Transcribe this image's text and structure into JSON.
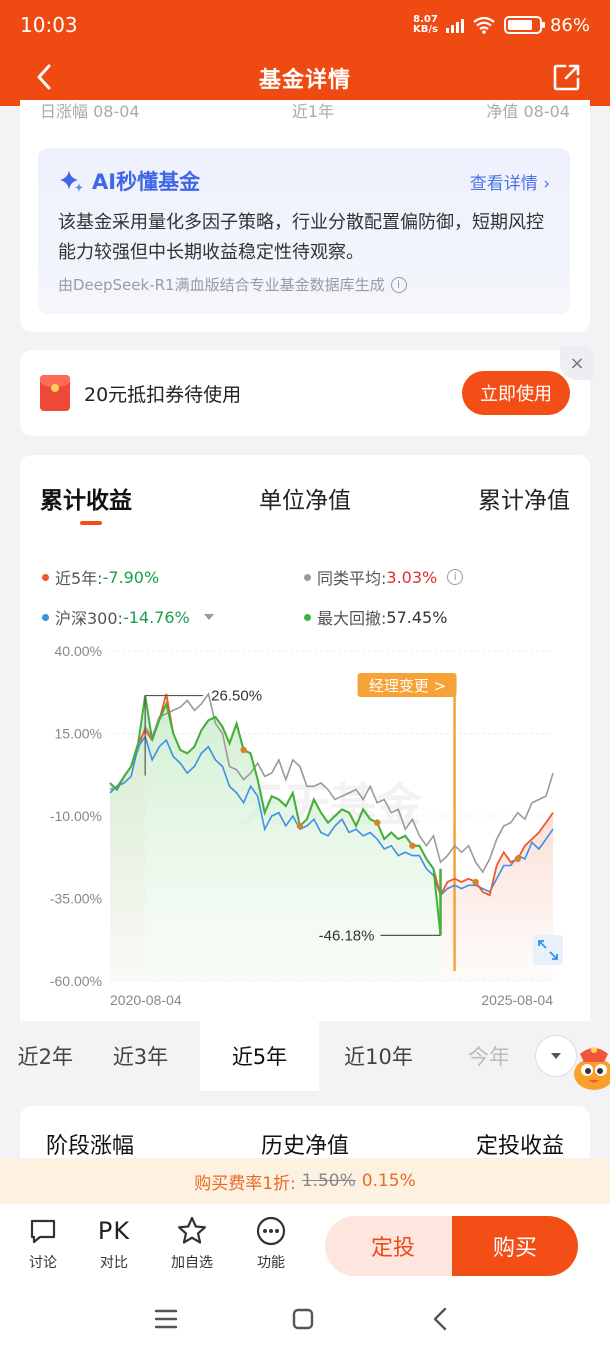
{
  "status_bar": {
    "time": "10:03",
    "net_speed_value": "8.07",
    "net_speed_unit": "KB/s",
    "battery": "86"
  },
  "header": {
    "title": "基金详情",
    "back_icon": "chevron-left-icon",
    "share_icon": "share-icon"
  },
  "peek_row": [
    "日涨幅 08-04",
    "近1年",
    "净值 08-04"
  ],
  "ai_card": {
    "title": "AI秒懂基金",
    "link": "查看详情 ›",
    "text": "该基金采用量化多因子策略，行业分散配置偏防御，短期风控能力较强但中长期收益稳定性待观察。",
    "source": "由DeepSeek-R1满血版结合专业基金数据库生成"
  },
  "coupon": {
    "text": "20元抵扣券待使用",
    "button": "立即使用",
    "close": "×"
  },
  "chart_tabs": [
    "累计收益",
    "单位净值",
    "累计净值"
  ],
  "legend": {
    "fund_label": "近5年:",
    "fund_value": "-7.90%",
    "peer_label": "同类平均:",
    "peer_value": "3.03%",
    "index_label": "沪深300:",
    "index_value": "-14.76%",
    "drawdown_label": "最大回撤:",
    "drawdown_value": "57.45%"
  },
  "colors": {
    "brand": "#f04a13",
    "fund": "#f0582a",
    "peer": "#9a9a9a",
    "index": "#3d8fe8",
    "drawdown": "#3fb23a",
    "up": "#e02c2c",
    "down": "#18a14a",
    "manager_change": "#f6a236"
  },
  "chart_data": {
    "type": "line",
    "x_start": "2020-08-04",
    "x_end": "2025-08-04",
    "xtick_labels": [
      "2020-08-04",
      "2025-08-04"
    ],
    "ytick_labels": [
      "40.00%",
      "15.00%",
      "-10.00%",
      "-35.00%",
      "-60.00%"
    ],
    "ylim": [
      -60,
      40
    ],
    "grid": true,
    "watermark": "天天基金",
    "peak_label": "26.50%",
    "trough_label": "-46.18%",
    "manager_change_label": "经理变更 >",
    "series": [
      {
        "name": "近5年",
        "values": [
          0,
          -2,
          2,
          5,
          12,
          16,
          13,
          19,
          27,
          15,
          10,
          9,
          11,
          16,
          19,
          20,
          17,
          12,
          18,
          10,
          9,
          1,
          -9,
          -4,
          -5,
          -7,
          -3,
          -13,
          -11,
          -5,
          -9,
          -12,
          -10,
          -8,
          -9,
          -13,
          -8,
          -11,
          -12,
          -17,
          -15,
          -17,
          -16,
          -19,
          -19,
          -23,
          -26,
          -34,
          -30,
          -29,
          -30,
          -29,
          -30,
          -33,
          -34,
          -25,
          -21,
          -24,
          -23,
          -19,
          -17,
          -15,
          -12,
          -9
        ]
      },
      {
        "name": "同类平均",
        "values": [
          -2,
          -1,
          2,
          5,
          10,
          17,
          14,
          20,
          21,
          22,
          23,
          25,
          22,
          24,
          27,
          18,
          15,
          5,
          4,
          1,
          3,
          6,
          2,
          3,
          7,
          1,
          7,
          5,
          -1,
          -1,
          0,
          -2,
          -5,
          -4,
          -3,
          -2,
          -5,
          -1,
          -6,
          -5,
          -9,
          -8,
          -14,
          -11,
          -16,
          -19,
          -16,
          -24,
          -22,
          -19,
          -21,
          -19,
          -24,
          -27,
          -23,
          -17,
          -13,
          -12,
          -9,
          -11,
          -6,
          -5,
          -4,
          3
        ]
      },
      {
        "name": "沪深300",
        "values": [
          -3,
          -1,
          0,
          2,
          11,
          14,
          7,
          11,
          13,
          8,
          6,
          3,
          5,
          9,
          11,
          7,
          5,
          -1,
          -3,
          -6,
          -1,
          -4,
          -14,
          -10,
          -9,
          -13,
          -10,
          -14,
          -13,
          -11,
          -15,
          -16,
          -13,
          -11,
          -15,
          -14,
          -16,
          -15,
          -17,
          -20,
          -19,
          -22,
          -21,
          -22,
          -22,
          -26,
          -28,
          -34,
          -32,
          -31,
          -32,
          -31,
          -31,
          -32,
          -33,
          -29,
          -25,
          -25,
          -22,
          -23,
          -18,
          -20,
          -17,
          -14
        ]
      },
      {
        "name": "最大回撤",
        "values": [
          0,
          -2,
          2,
          5,
          12,
          26.5,
          13,
          19,
          24,
          15,
          10,
          9,
          11,
          16,
          19,
          20,
          17,
          12,
          18,
          10,
          9,
          1,
          -9,
          -4,
          -5,
          -7,
          -3,
          -13,
          -11,
          -5,
          -9,
          -12,
          -10,
          -8,
          -9,
          -13,
          -8,
          -11,
          -12,
          -17,
          -15,
          -17,
          -16,
          -19,
          -19,
          -23,
          -26,
          -46.18
        ]
      }
    ]
  },
  "periods": [
    "近2年",
    "近3年",
    "近5年",
    "近10年",
    "今年来"
  ],
  "sections": [
    "阶段涨幅",
    "历史净值",
    "定投收益"
  ],
  "fee": {
    "label": "购买费率1折:",
    "old": "1.50%",
    "new": "0.15%"
  },
  "bottom": {
    "discuss": "讨论",
    "pk": "PK",
    "compare": "对比",
    "watch": "加自选",
    "more": "功能",
    "sip": "定投",
    "buy": "购买"
  }
}
